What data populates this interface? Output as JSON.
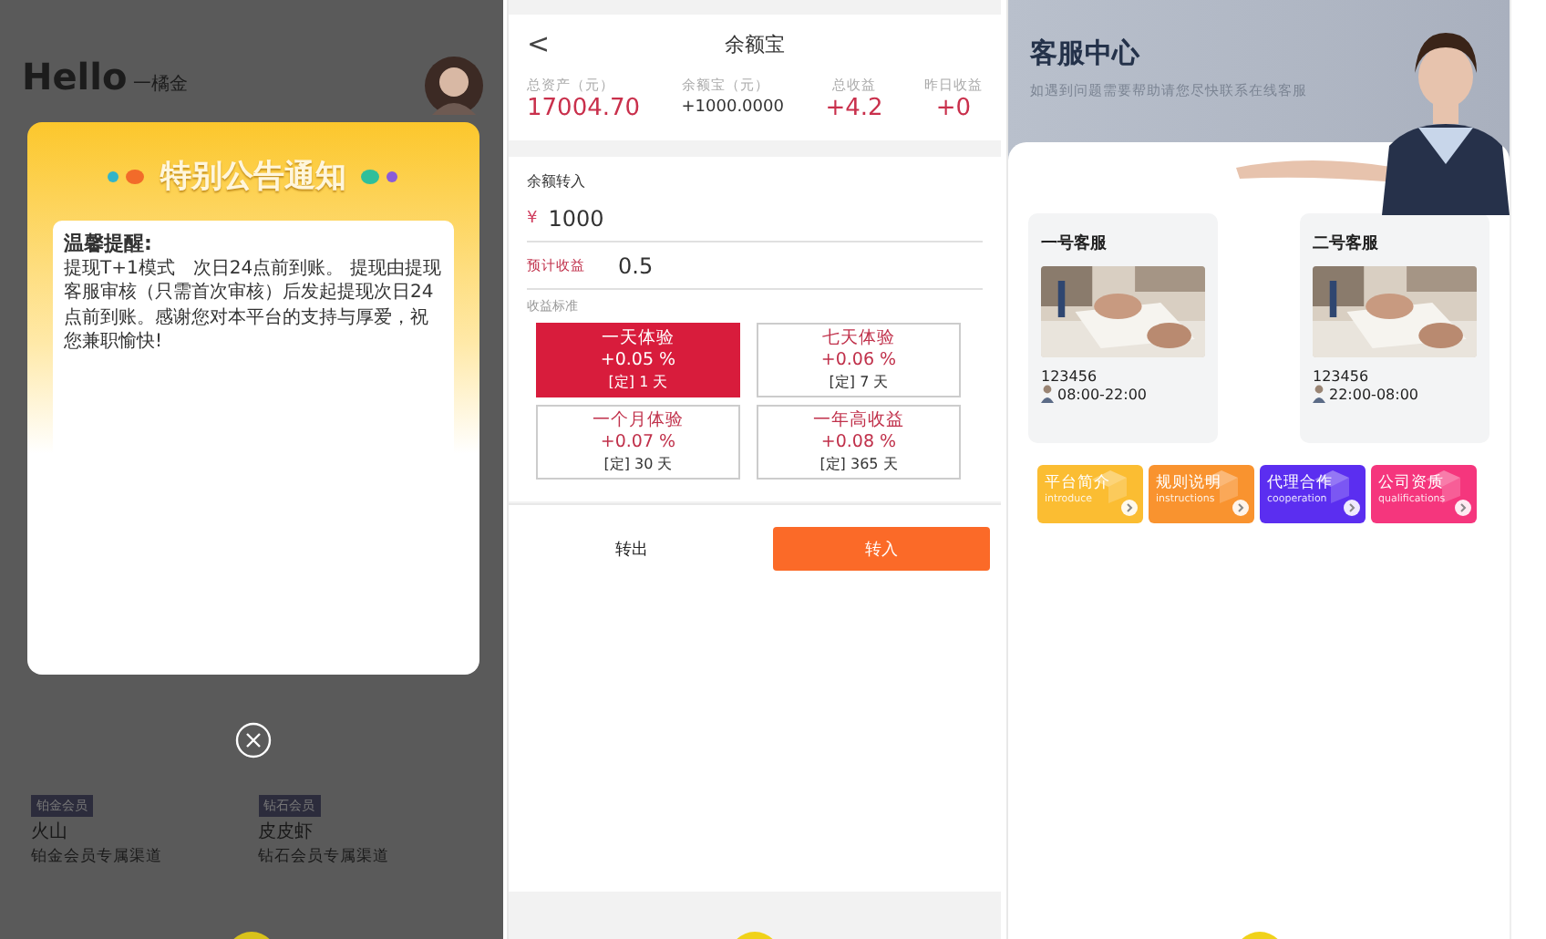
{
  "home": {
    "greeting": "Hello",
    "brand": "一橘金",
    "members": [
      {
        "badge": "铂金会员",
        "name": "火山",
        "desc": "铂金会员专属渠道"
      },
      {
        "badge": "钻石会员",
        "name": "皮皮虾",
        "desc": "钻石会员专属渠道"
      }
    ],
    "notice": {
      "title": "特别公告通知",
      "heading": "温馨提醒:",
      "body": "提现T+1模式　次日24点前到账。 提现由提现客服审核（只需首次审核）后发起提现次日24点前到账。感谢您对本平台的支持与厚爱，祝您兼职愉快!"
    }
  },
  "balance": {
    "back": "<",
    "title": "余额宝",
    "stats": [
      {
        "label": "总资产（元）",
        "value": "17004.70",
        "kind": "big"
      },
      {
        "label": "余额宝（元）",
        "value": "+1000.0000",
        "kind": "plain"
      },
      {
        "label": "总收益",
        "value": "+4.2",
        "kind": "big"
      },
      {
        "label": "昨日收益",
        "value": "+0",
        "kind": "big"
      }
    ],
    "transfer_label": "余额转入",
    "currency": "¥",
    "amount": "1000",
    "expected_label": "预计收益",
    "expected": "0.5",
    "plans_label": "收益标准",
    "plans": [
      {
        "name": "一天体验",
        "rate": "+0.05 %",
        "term": "[定] 1 天",
        "selected": true
      },
      {
        "name": "七天体验",
        "rate": "+0.06 %",
        "term": "[定] 7 天",
        "selected": false
      },
      {
        "name": "一个月体验",
        "rate": "+0.07 %",
        "term": "[定] 30 天",
        "selected": false
      },
      {
        "name": "一年高收益",
        "rate": "+0.08 %",
        "term": "[定] 365 天",
        "selected": false
      }
    ],
    "buttons": [
      {
        "label": "转出",
        "kind": "plain"
      },
      {
        "label": "转入",
        "kind": "primary"
      }
    ]
  },
  "service": {
    "title": "客服中心",
    "subtitle": "如遇到问题需要帮助请您尽快联系在线客服",
    "agents": [
      {
        "name": "一号客服",
        "id": "123456",
        "hours": "08:00-22:00"
      },
      {
        "name": "二号客服",
        "id": "123456",
        "hours": "22:00-08:00"
      }
    ],
    "links": [
      {
        "title": "平台简介",
        "subtitle": "introduce",
        "color": "#fbbd32"
      },
      {
        "title": "规则说明",
        "subtitle": "instructions",
        "color": "#f9932f"
      },
      {
        "title": "代理合作",
        "subtitle": "cooperation",
        "color": "#5b2ef0"
      },
      {
        "title": "公司资质",
        "subtitle": "qualifications",
        "color": "#f5367d"
      }
    ]
  }
}
